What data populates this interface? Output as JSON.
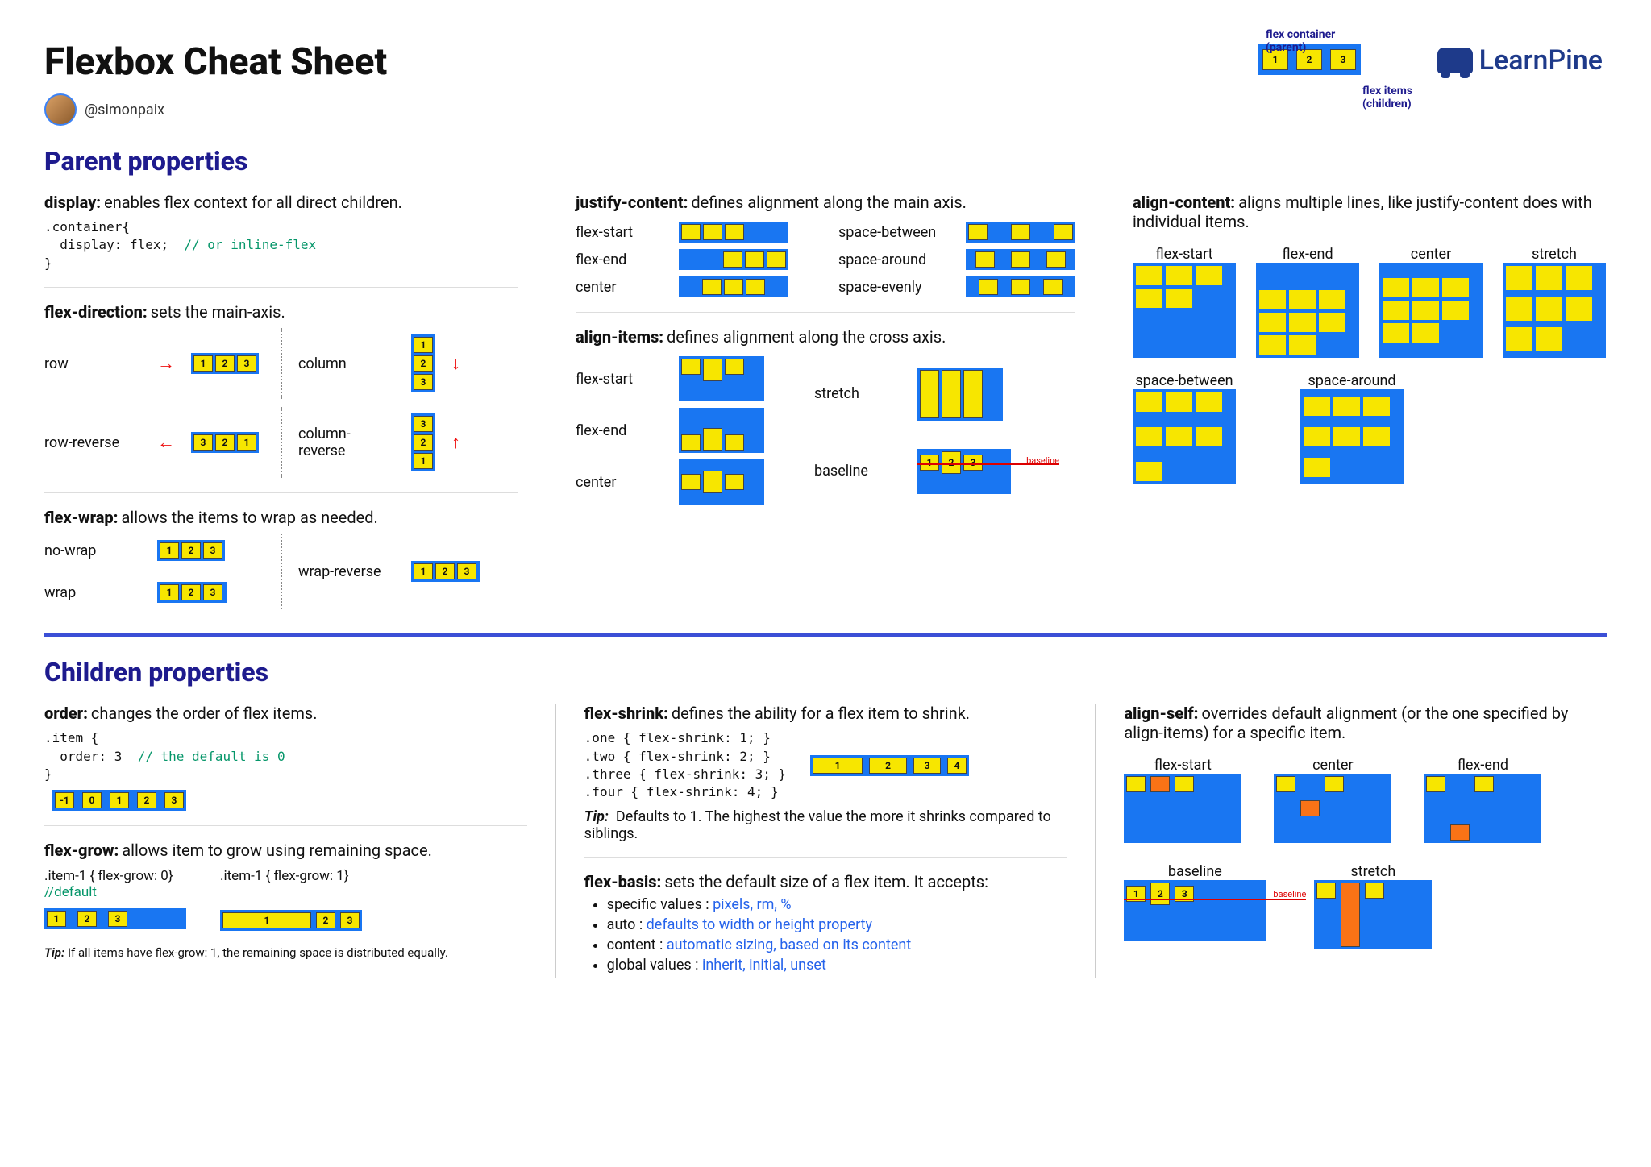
{
  "title": "Flexbox Cheat Sheet",
  "handle": "@simonpaix",
  "brand": "LearnPine",
  "topdiag": {
    "parent": "flex container (parent)",
    "children": "flex items\n(children)",
    "items": [
      "1",
      "2",
      "3"
    ]
  },
  "parent_section": "Parent properties",
  "display": {
    "title": "display:",
    "desc": "enables flex context for all direct children.",
    "code": ".container{\n  display: flex;  ",
    "comment": "// or inline-flex",
    "close": "\n}"
  },
  "flex_direction": {
    "title": "flex-direction:",
    "desc": "sets the main-axis.",
    "row": "row",
    "row_rev": "row-reverse",
    "col": "column",
    "col_rev": "column-reverse",
    "nums": [
      "1",
      "2",
      "3"
    ],
    "nums_rev": [
      "3",
      "2",
      "1"
    ]
  },
  "flex_wrap": {
    "title": "flex-wrap:",
    "desc": "allows the items to wrap as needed.",
    "nowrap": "no-wrap",
    "wrap": "wrap",
    "wrap_rev": "wrap-reverse",
    "nums": [
      "1",
      "2",
      "3"
    ]
  },
  "justify": {
    "title": "justify-content:",
    "desc": "defines alignment along the main axis.",
    "fs": "flex-start",
    "fe": "flex-end",
    "c": "center",
    "sb": "space-between",
    "sa": "space-around",
    "se": "space-evenly"
  },
  "align_items": {
    "title": "align-items:",
    "desc": "defines alignment along the cross axis.",
    "fs": "flex-start",
    "fe": "flex-end",
    "c": "center",
    "st": "stretch",
    "bl": "baseline",
    "bl_lbl": "baseline",
    "nums": [
      "1",
      "2",
      "3"
    ]
  },
  "align_content": {
    "title": "align-content:",
    "desc": "aligns multiple lines, like justify-content does with individual items.",
    "fs": "flex-start",
    "fe": "flex-end",
    "c": "center",
    "st": "stretch",
    "sb": "space-between",
    "sa": "space-around"
  },
  "children_section": "Children properties",
  "order": {
    "title": "order:",
    "desc": "changes the order of flex items.",
    "code": ".item {\n  order: 3  ",
    "comment": "// the default is 0",
    "close": "\n}",
    "vals": [
      "-1",
      "0",
      "1",
      "2",
      "3"
    ]
  },
  "flex_grow": {
    "title": "flex-grow:",
    "desc": "allows item to grow using remaining space.",
    "left": ".item-1 { flex-grow: 0}",
    "left_def": "//default",
    "right": ".item-1 { flex-grow: 1}",
    "nums": [
      "1",
      "2",
      "3"
    ],
    "tip_lbl": "Tip:",
    "tip": "If all items have flex-grow: 1, the remaining space is distributed equally."
  },
  "flex_shrink": {
    "title": "flex-shrink:",
    "desc": "defines the ability for a flex item to shrink.",
    "code": ".one { flex-shrink: 1; }\n.two { flex-shrink: 2; }\n.three { flex-shrink: 3; }\n.four { flex-shrink: 4; }",
    "nums": [
      "1",
      "2",
      "3",
      "4"
    ],
    "tip_lbl": "Tip:",
    "tip": "Defaults to 1. The highest the value the more it shrinks compared to siblings."
  },
  "flex_basis": {
    "title": "flex-basis:",
    "desc": "sets the default size of a flex item. It accepts:",
    "b1a": "specific values  : ",
    "b1b": "pixels, rm, %",
    "b2a": "auto : ",
    "b2b": "defaults to width or height property",
    "b3a": "content : ",
    "b3b": "automatic sizing, based on its content",
    "b4a": "global values : ",
    "b4b": "inherit, initial, unset"
  },
  "align_self": {
    "title": "align-self:",
    "desc": "overrides default alignment (or the one specified by align-items) for a specific item.",
    "fs": "flex-start",
    "c": "center",
    "fe": "flex-end",
    "bl": "baseline",
    "st": "stretch",
    "bl_lbl": "baseline",
    "nums": [
      "1",
      "2",
      "3"
    ]
  }
}
